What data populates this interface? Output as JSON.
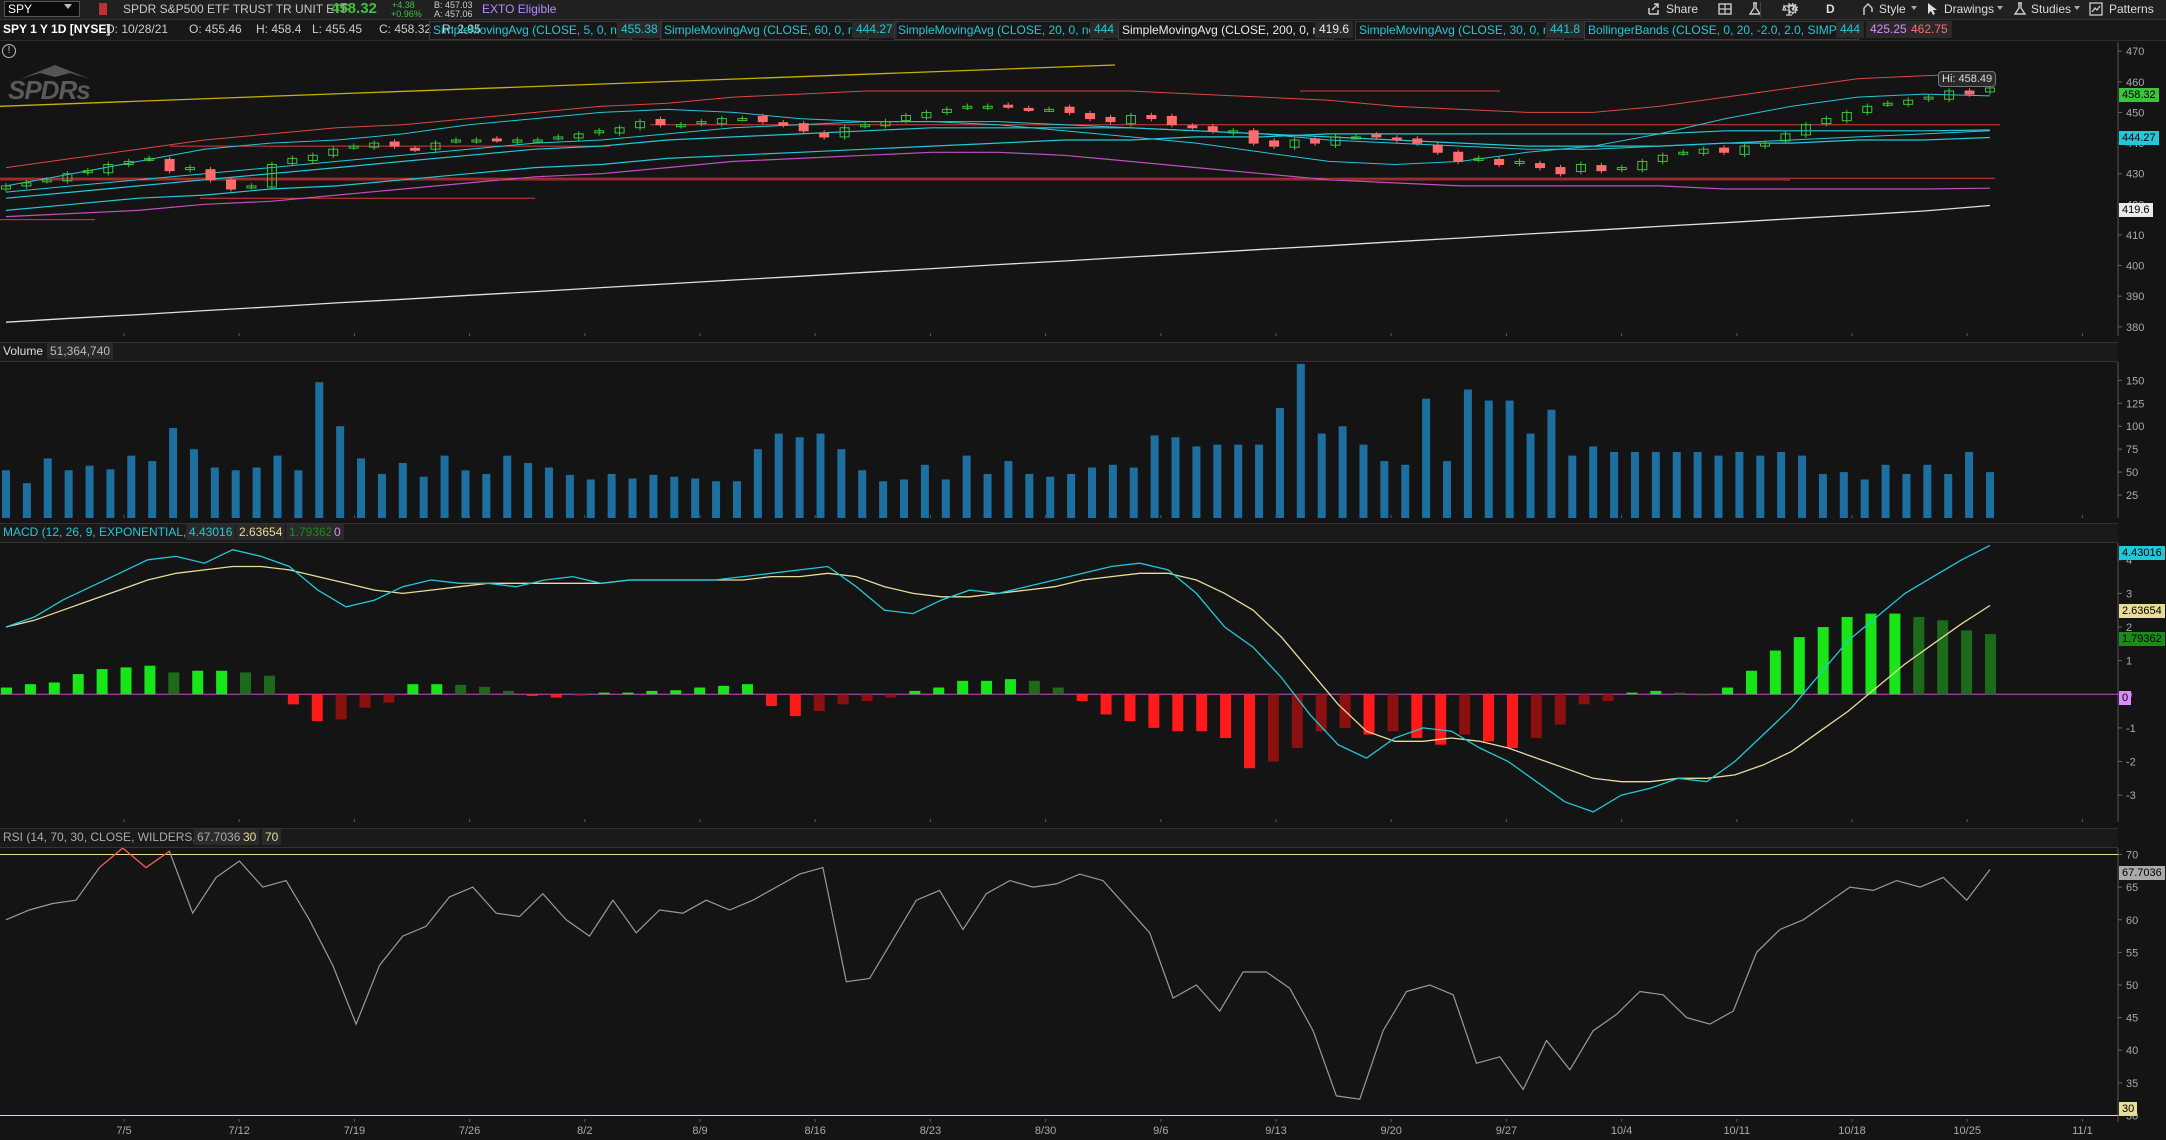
{
  "toolbar": {
    "symbol": "SPY",
    "description": "SPDR S&P500 ETF TRUST TR UNIT ETF",
    "last": "458.32",
    "change": "+4.38",
    "change_pct": "+0.96%",
    "bid": "B: 457.03",
    "ask": "A: 457.06",
    "exto": "EXTO Eligible",
    "share": "Share",
    "period": "D",
    "style": "Style",
    "drawings": "Drawings",
    "studies": "Studies",
    "patterns": "Patterns"
  },
  "studies_bar": {
    "chart_label": "SPY 1 Y 1D [NYSE]",
    "date": "D: 10/28/21",
    "open": "O: 455.46",
    "high": "H: 458.4",
    "low": "L: 455.45",
    "close": "C: 458.32",
    "range": "R: 2.95",
    "sma5_label": "SimpleMovingAvg (CLOSE, 5, 0, no)",
    "sma5_value": "455.38",
    "sma60_label": "SimpleMovingAvg (CLOSE, 60, 0, no)",
    "sma60_value": "444.27",
    "sma20_label": "SimpleMovingAvg (CLOSE, 20, 0, no)",
    "sma20_value": "444",
    "sma200_label": "SimpleMovingAvg (CLOSE, 200, 0, no)",
    "sma200_value": "419.6",
    "sma30_label": "SimpleMovingAvg (CLOSE, 30, 0, no)",
    "sma30_value": "441.8",
    "bb_label": "BollingerBands (CLOSE, 0, 20, -2.0, 2.0, SIMPLE)",
    "bb_mid": "444",
    "bb_low": "425.25",
    "bb_high": "462.75"
  },
  "price_pane": {
    "logo": "SPDRs",
    "hi_tag": "Hi: 458.49",
    "tags": {
      "last": "458.32",
      "sma60": "444.27",
      "sma200": "419.6"
    }
  },
  "volume_pane": {
    "label": "Volume",
    "value": "51,364,740"
  },
  "macd_pane": {
    "label": "MACD (12, 26, 9, EXPONENTIAL, no)",
    "value": "4.43016",
    "avg": "2.63654",
    "diff": "1.79362",
    "zero": "0",
    "tags": {
      "value": "4.43016",
      "avg": "2.63654",
      "diff": "1.79362",
      "zero": "0"
    }
  },
  "rsi_pane": {
    "label": "RSI (14, 70, 30, CLOSE, WILDERS, no)",
    "value": "67.7036",
    "os": "30",
    "ob": "70",
    "tags": {
      "value": "67.7036",
      "ob": "70",
      "os": "30"
    }
  },
  "colors": {
    "up": "#3cc23c",
    "down": "#ff6b6b",
    "volume": "#1d6fa0",
    "macd_value": "#22c8d8",
    "macd_avg": "#e8dc9a",
    "hist_up": "#19e619",
    "hist_up_weak": "#1b6b1b",
    "hist_down": "#ff1a1a",
    "hist_down_weak": "#8b1010",
    "sma200": "#e0e0e0",
    "rsi": "#9a9a9a",
    "bb": "#e04545"
  },
  "chart_data": [
    {
      "type": "candlestick",
      "title": "SPY 1 Y 1D [NYSE]",
      "x_ticks": [
        "7/5",
        "7/12",
        "7/19",
        "7/26",
        "8/2",
        "8/9",
        "8/16",
        "8/23",
        "8/30",
        "9/6",
        "9/13",
        "9/20",
        "9/27",
        "10/4",
        "10/11",
        "10/18",
        "10/25",
        "11/1"
      ],
      "y_ticks": [
        380,
        390,
        400,
        410,
        420,
        430,
        440,
        450,
        460,
        470
      ],
      "ylim": [
        377,
        473
      ],
      "close": [
        426,
        427,
        428,
        430,
        431,
        433,
        434,
        435,
        431,
        432,
        428,
        425,
        426,
        433,
        435,
        436,
        438,
        439,
        440,
        439,
        438,
        440,
        441,
        441,
        441,
        441,
        441,
        442,
        443,
        444,
        445,
        447,
        446,
        446,
        447,
        448,
        448,
        447,
        446,
        444,
        442,
        445,
        446,
        447,
        449,
        450,
        451,
        452,
        452,
        452,
        451,
        451,
        450,
        448,
        447,
        449,
        448,
        446,
        445,
        444,
        444,
        440,
        439,
        441,
        440,
        442,
        442,
        442,
        441,
        440,
        437,
        434,
        435,
        433,
        434,
        432,
        430,
        433,
        431,
        432,
        434,
        436,
        437,
        438,
        437,
        439,
        440,
        443,
        446,
        448,
        450,
        452,
        453,
        454,
        455,
        457,
        456,
        458
      ],
      "series_lines": {
        "sma200": [
          381.5,
          382.8,
          384.0,
          385.3,
          386.5,
          387.8,
          389.0,
          390.3,
          391.5,
          392.8,
          394.0,
          395.3,
          396.5,
          397.8,
          399.0,
          400.3,
          401.5,
          402.8,
          404.0,
          405.3,
          406.5,
          407.8,
          409.0,
          410.3,
          411.5,
          412.8,
          414.0,
          415.3,
          416.5,
          417.8,
          419.6
        ],
        "sma5": [
          426,
          430,
          434,
          438,
          440,
          441,
          443,
          446,
          448,
          450,
          451,
          450,
          448,
          447,
          447,
          446,
          444,
          442,
          440,
          437,
          434,
          433,
          434,
          437,
          439,
          443,
          448,
          452,
          455,
          456,
          455.4
        ],
        "sma20": [
          424,
          426,
          428,
          430,
          432,
          434,
          436,
          438,
          440,
          441,
          443,
          445,
          446,
          447,
          447,
          447,
          446,
          445,
          444,
          443,
          441,
          440,
          439,
          438,
          438,
          439,
          440,
          441,
          442,
          443,
          444
        ],
        "sma30": [
          422,
          424,
          426,
          428,
          430,
          432,
          434,
          436,
          438,
          439,
          441,
          442,
          443,
          444,
          445,
          445,
          445,
          445,
          444,
          443,
          442,
          441,
          440,
          439,
          439,
          439,
          440,
          440,
          441,
          441,
          441.8
        ],
        "sma60": [
          418,
          420,
          422,
          423,
          425,
          426,
          428,
          430,
          432,
          433,
          435,
          436,
          437,
          438,
          439,
          440,
          441,
          441,
          442,
          442,
          443,
          443,
          443,
          443,
          443,
          443,
          444,
          444,
          444,
          444,
          444.27
        ],
        "bb_upper": [
          432,
          435,
          438,
          441,
          443,
          445,
          446,
          448,
          450,
          452,
          453,
          455,
          456,
          457,
          457,
          457,
          457,
          457,
          456,
          455,
          454,
          452,
          451,
          450,
          450,
          452,
          455,
          458,
          461,
          462,
          462.75
        ],
        "bb_lower": [
          416,
          417,
          418,
          420,
          421,
          423,
          425,
          427,
          429,
          430,
          432,
          434,
          435,
          436,
          437,
          437,
          436,
          434,
          432,
          430,
          428,
          427,
          426,
          426,
          426,
          426,
          425,
          425,
          425,
          425,
          425.25
        ]
      }
    },
    {
      "type": "bar",
      "title": "Volume",
      "y_ticks": [
        25,
        50,
        75,
        100,
        125,
        150
      ],
      "ylim": [
        0,
        170
      ],
      "values": [
        52,
        38,
        65,
        52,
        57,
        53,
        68,
        62,
        98,
        75,
        55,
        52,
        55,
        68,
        52,
        148,
        100,
        65,
        48,
        60,
        45,
        68,
        52,
        48,
        68,
        60,
        55,
        47,
        42,
        48,
        43,
        47,
        45,
        43,
        40,
        40,
        75,
        92,
        88,
        92,
        75,
        52,
        40,
        42,
        58,
        42,
        68,
        48,
        62,
        48,
        45,
        48,
        55,
        58,
        55,
        90,
        88,
        78,
        80,
        80,
        80,
        120,
        168,
        92,
        100,
        80,
        62,
        58,
        130,
        62,
        140,
        128,
        128,
        92,
        118,
        68,
        78,
        72,
        72,
        72,
        72,
        72,
        68,
        72,
        68,
        72,
        68,
        48,
        50,
        42,
        58,
        48,
        58,
        48,
        72,
        50
      ]
    },
    {
      "type": "line+bar",
      "title": "MACD (12, 26, 9, EXPONENTIAL, no)",
      "y_ticks": [
        -3,
        -2,
        -1,
        0,
        1,
        2,
        3,
        4
      ],
      "ylim": [
        -3.8,
        4.5
      ],
      "value": [
        2.0,
        2.3,
        2.8,
        3.2,
        3.6,
        4.0,
        4.1,
        3.9,
        4.3,
        4.1,
        3.8,
        3.1,
        2.6,
        2.8,
        3.2,
        3.4,
        3.3,
        3.3,
        3.2,
        3.4,
        3.5,
        3.3,
        3.4,
        3.4,
        3.4,
        3.4,
        3.5,
        3.6,
        3.7,
        3.8,
        3.2,
        2.5,
        2.4,
        2.8,
        3.1,
        3.0,
        3.2,
        3.4,
        3.6,
        3.8,
        3.9,
        3.7,
        3.0,
        2.0,
        1.4,
        0.5,
        -0.6,
        -1.5,
        -1.9,
        -1.3,
        -1.0,
        -1.1,
        -1.6,
        -2.0,
        -2.6,
        -3.2,
        -3.5,
        -3.0,
        -2.8,
        -2.5,
        -2.6,
        -2.0,
        -1.2,
        -0.4,
        0.6,
        1.6,
        2.3,
        3.0,
        3.5,
        4.0,
        4.43
      ],
      "avg": [
        2.0,
        2.2,
        2.5,
        2.8,
        3.1,
        3.4,
        3.6,
        3.7,
        3.8,
        3.8,
        3.7,
        3.5,
        3.3,
        3.1,
        3.0,
        3.1,
        3.2,
        3.3,
        3.3,
        3.3,
        3.3,
        3.3,
        3.4,
        3.4,
        3.4,
        3.4,
        3.4,
        3.5,
        3.5,
        3.6,
        3.5,
        3.2,
        3.0,
        2.9,
        2.9,
        3.0,
        3.1,
        3.2,
        3.4,
        3.5,
        3.6,
        3.6,
        3.4,
        3.0,
        2.5,
        1.7,
        0.7,
        -0.3,
        -1.1,
        -1.4,
        -1.4,
        -1.3,
        -1.4,
        -1.6,
        -1.9,
        -2.2,
        -2.5,
        -2.6,
        -2.6,
        -2.5,
        -2.5,
        -2.4,
        -2.1,
        -1.7,
        -1.1,
        -0.5,
        0.2,
        0.9,
        1.5,
        2.1,
        2.64
      ],
      "histogram": [
        0.2,
        0.3,
        0.35,
        0.6,
        0.75,
        0.8,
        0.85,
        0.65,
        0.7,
        0.7,
        0.65,
        0.55,
        -0.3,
        -0.8,
        -0.75,
        -0.4,
        -0.25,
        0.3,
        0.3,
        0.28,
        0.22,
        0.1,
        -0.05,
        -0.1,
        -0.05,
        0.05,
        0.05,
        0.1,
        0.12,
        0.2,
        0.25,
        0.3,
        -0.35,
        -0.65,
        -0.5,
        -0.3,
        -0.2,
        -0.1,
        0.1,
        0.2,
        0.4,
        0.4,
        0.45,
        0.4,
        0.2,
        -0.2,
        -0.6,
        -0.8,
        -1.0,
        -1.1,
        -1.1,
        -1.3,
        -2.2,
        -2.0,
        -1.6,
        -1.1,
        -1.0,
        -1.2,
        -1.1,
        -1.3,
        -1.5,
        -1.2,
        -1.4,
        -1.6,
        -1.3,
        -0.9,
        -0.3,
        -0.2,
        0.05,
        0.1,
        0.05,
        0.0,
        0.2,
        0.7,
        1.3,
        1.7,
        2.0,
        2.3,
        2.4,
        2.4,
        2.3,
        2.2,
        1.9,
        1.79
      ],
      "zero_line": 0
    },
    {
      "type": "line",
      "title": "RSI (14, 70, 30, CLOSE, WILDERS, no)",
      "y_ticks": [
        30,
        35,
        40,
        45,
        50,
        55,
        60,
        65,
        70
      ],
      "ylim": [
        29,
        71
      ],
      "overbought": 70,
      "oversold": 30,
      "values": [
        60,
        61.5,
        62.5,
        63,
        68,
        71,
        68,
        70.5,
        61,
        66.5,
        69,
        65,
        66,
        60,
        53,
        44,
        53,
        57.5,
        59,
        63.5,
        65,
        61,
        60.5,
        64,
        60,
        57.5,
        63,
        58,
        61.5,
        61,
        63,
        61.5,
        63,
        65,
        67,
        68,
        50.5,
        51,
        57,
        63,
        64.5,
        58.5,
        64,
        66,
        65,
        65.5,
        67,
        66,
        62,
        58,
        48,
        50,
        46,
        52,
        52,
        49.5,
        43,
        33,
        32.5,
        43,
        49,
        50,
        48.5,
        38,
        39,
        34,
        41.5,
        37,
        43,
        45.5,
        49,
        48.5,
        45,
        44,
        46,
        55,
        58.5,
        60,
        62.5,
        65,
        64.5,
        66,
        65,
        66.5,
        63,
        67.7
      ]
    }
  ]
}
